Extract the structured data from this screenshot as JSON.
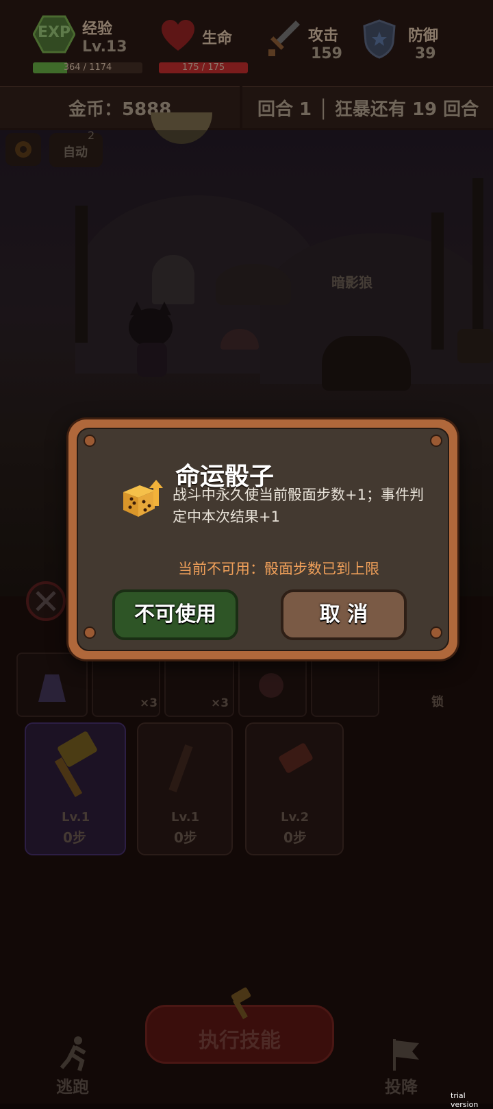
{
  "stats": {
    "exp": {
      "icon_text": "EXP",
      "label": "经验",
      "level": "Lv.13",
      "bar_text": "364 / 1174",
      "progress": 0.31
    },
    "hp": {
      "label": "生命",
      "bar_text": "175 / 175",
      "progress": 1.0
    },
    "attack": {
      "label": "攻击",
      "value": "159"
    },
    "defense": {
      "label": "防御",
      "value": "39"
    }
  },
  "info": {
    "gold": "金币：5888",
    "round": "回合 1 │ 狂暴还有 19 回合"
  },
  "scene": {
    "auto_label": "自动",
    "auto_count": "2",
    "enemy_name": "暗影狼"
  },
  "items": {
    "x3_a": "×3",
    "x3_b": "×3",
    "lock": "锁"
  },
  "skills": [
    {
      "level": "Lv.1",
      "steps": "0步"
    },
    {
      "level": "Lv.1",
      "steps": "0步"
    },
    {
      "level": "Lv.2",
      "steps": "0步"
    }
  ],
  "bottom": {
    "flee": "逃跑",
    "execute": "执行技能",
    "surrender": "投降"
  },
  "dialog": {
    "title": "命运骰子",
    "desc_line1": "战斗中永久使当前骰面步数+1；事件判",
    "desc_line2": "定中本次结果+1",
    "unavailable": "当前不可用：骰面步数已到上限",
    "use_button": "不可使用",
    "cancel_button": "取 消"
  },
  "watermark": "trial version",
  "colors": {
    "accent_orange": "#f0a05a",
    "hp_red": "#7a1c1c",
    "exp_green": "#3f6b2a",
    "use_green": "#2e5526",
    "cancel_brown": "#7a5a45"
  }
}
